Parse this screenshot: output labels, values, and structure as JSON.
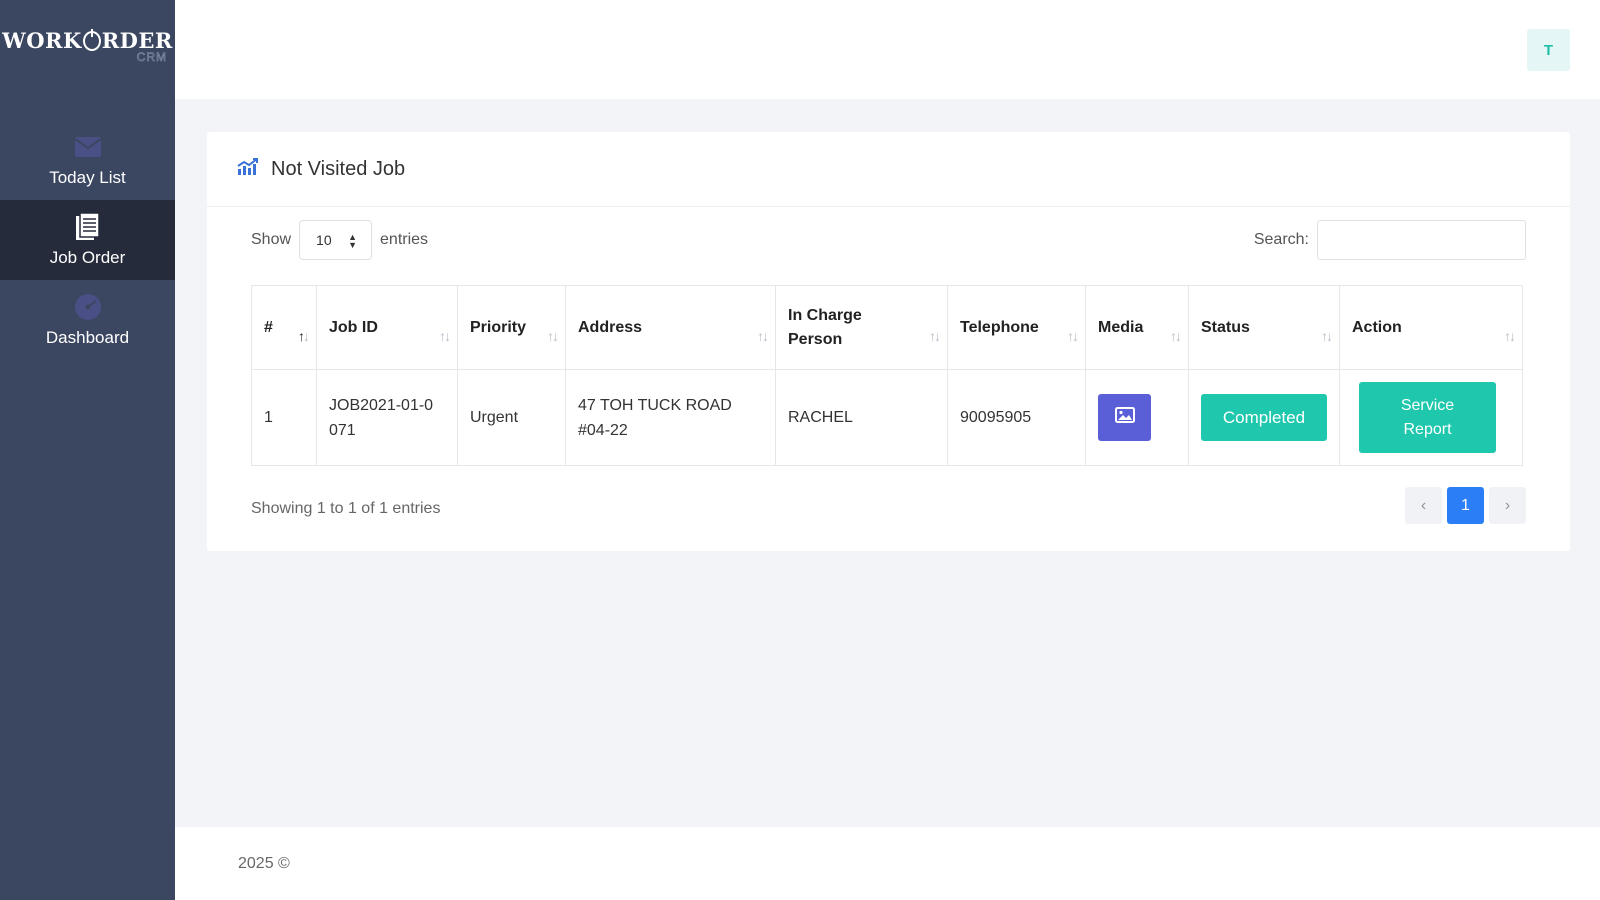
{
  "brand": {
    "name_left": "WORK",
    "name_right": "RDER",
    "sub": "CRM"
  },
  "sidebar": {
    "items": [
      {
        "label": "Today List",
        "icon": "envelope-icon",
        "active": false
      },
      {
        "label": "Job Order",
        "icon": "document-icon",
        "active": true
      },
      {
        "label": "Dashboard",
        "icon": "dashboard-icon",
        "active": false
      }
    ]
  },
  "header": {
    "avatar_initial": "T"
  },
  "card": {
    "title": "Not Visited Job",
    "show_label": "Show",
    "entries_value": "10",
    "entries_label": "entries",
    "search_label": "Search:",
    "search_value": ""
  },
  "table": {
    "columns": [
      "#",
      "Job ID",
      "Priority",
      "Address",
      "In Charge Person",
      "Telephone",
      "Media",
      "Status",
      "Action"
    ],
    "rows": [
      {
        "num": "1",
        "job_id": "JOB2021-01-0071",
        "priority": "Urgent",
        "address": "47 TOH TUCK ROAD #04-22",
        "person": "RACHEL",
        "telephone": "90095905",
        "media_icon": "image-icon",
        "status": "Completed",
        "action": "Service Report"
      }
    ]
  },
  "pagination": {
    "info": "Showing 1 to 1 of 1 entries",
    "prev": "‹",
    "current": "1",
    "next": "›"
  },
  "footer": {
    "text": "2025 ©"
  },
  "colors": {
    "sidebar": "#3b4660",
    "sidebar_active": "#252b3b",
    "teal": "#1fc7ad",
    "media": "#5a5fd8",
    "page_blue": "#2b7ef5"
  }
}
